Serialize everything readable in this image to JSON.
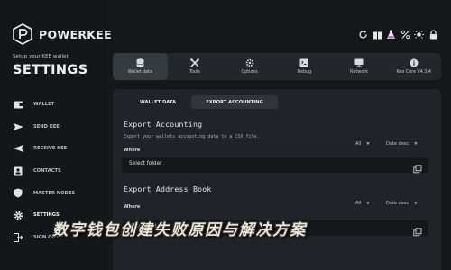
{
  "brand": {
    "name": "POWERKEE",
    "logo_icon": "powerkee-logo-icon"
  },
  "sidebar": {
    "setup_label": "Setup your KEE wallet",
    "title": "SETTINGS",
    "items": [
      {
        "label": "WALLET",
        "icon": "wallet-icon"
      },
      {
        "label": "SEND KEE",
        "icon": "send-arrow-icon"
      },
      {
        "label": "RECEIVE KEE",
        "icon": "receive-arrow-icon"
      },
      {
        "label": "CONTACTS",
        "icon": "contacts-icon"
      },
      {
        "label": "MASTER NODES",
        "icon": "shield-icon"
      },
      {
        "label": "SETTINGS",
        "icon": "gear-icon",
        "active": true
      },
      {
        "label": "SIGN OUT",
        "icon": "sign-out-icon"
      }
    ]
  },
  "topbar": {
    "icons": [
      "refresh-icon",
      "gift-icon",
      "flask-icon",
      "percent-icon",
      "sun-icon",
      "lock-icon"
    ]
  },
  "tabs": [
    {
      "label": "Wallet data",
      "icon": "database-icon",
      "active": true
    },
    {
      "label": "Tools",
      "icon": "tools-icon"
    },
    {
      "label": "Options",
      "icon": "options-icon"
    },
    {
      "label": "Debug",
      "icon": "debug-icon"
    },
    {
      "label": "Network",
      "icon": "network-icon"
    },
    {
      "label": "Kee Core V4.3.4",
      "icon": "info-icon"
    }
  ],
  "subtabs": {
    "wallet_data": "WALLET DATA",
    "export_accounting": "EXPORT ACCOUNTING"
  },
  "export_accounting": {
    "title": "Export Accounting",
    "description": "Export your wallets accounting data to a CSV file.",
    "where_label": "Where",
    "filter_value": "All",
    "sort_value": "Date desc",
    "folder_placeholder": "Select folder"
  },
  "export_address_book": {
    "title": "Export Address Book",
    "where_label": "Where",
    "filter_value": "All",
    "sort_value": "Date desc",
    "folder_placeholder": "Select folder"
  },
  "overlay_caption": "数字钱包创建失败原因与解决方案",
  "colors": {
    "background": "#15181b",
    "panel": "#202428",
    "tabbar": "#23272b",
    "active_tab": "#363b40"
  }
}
